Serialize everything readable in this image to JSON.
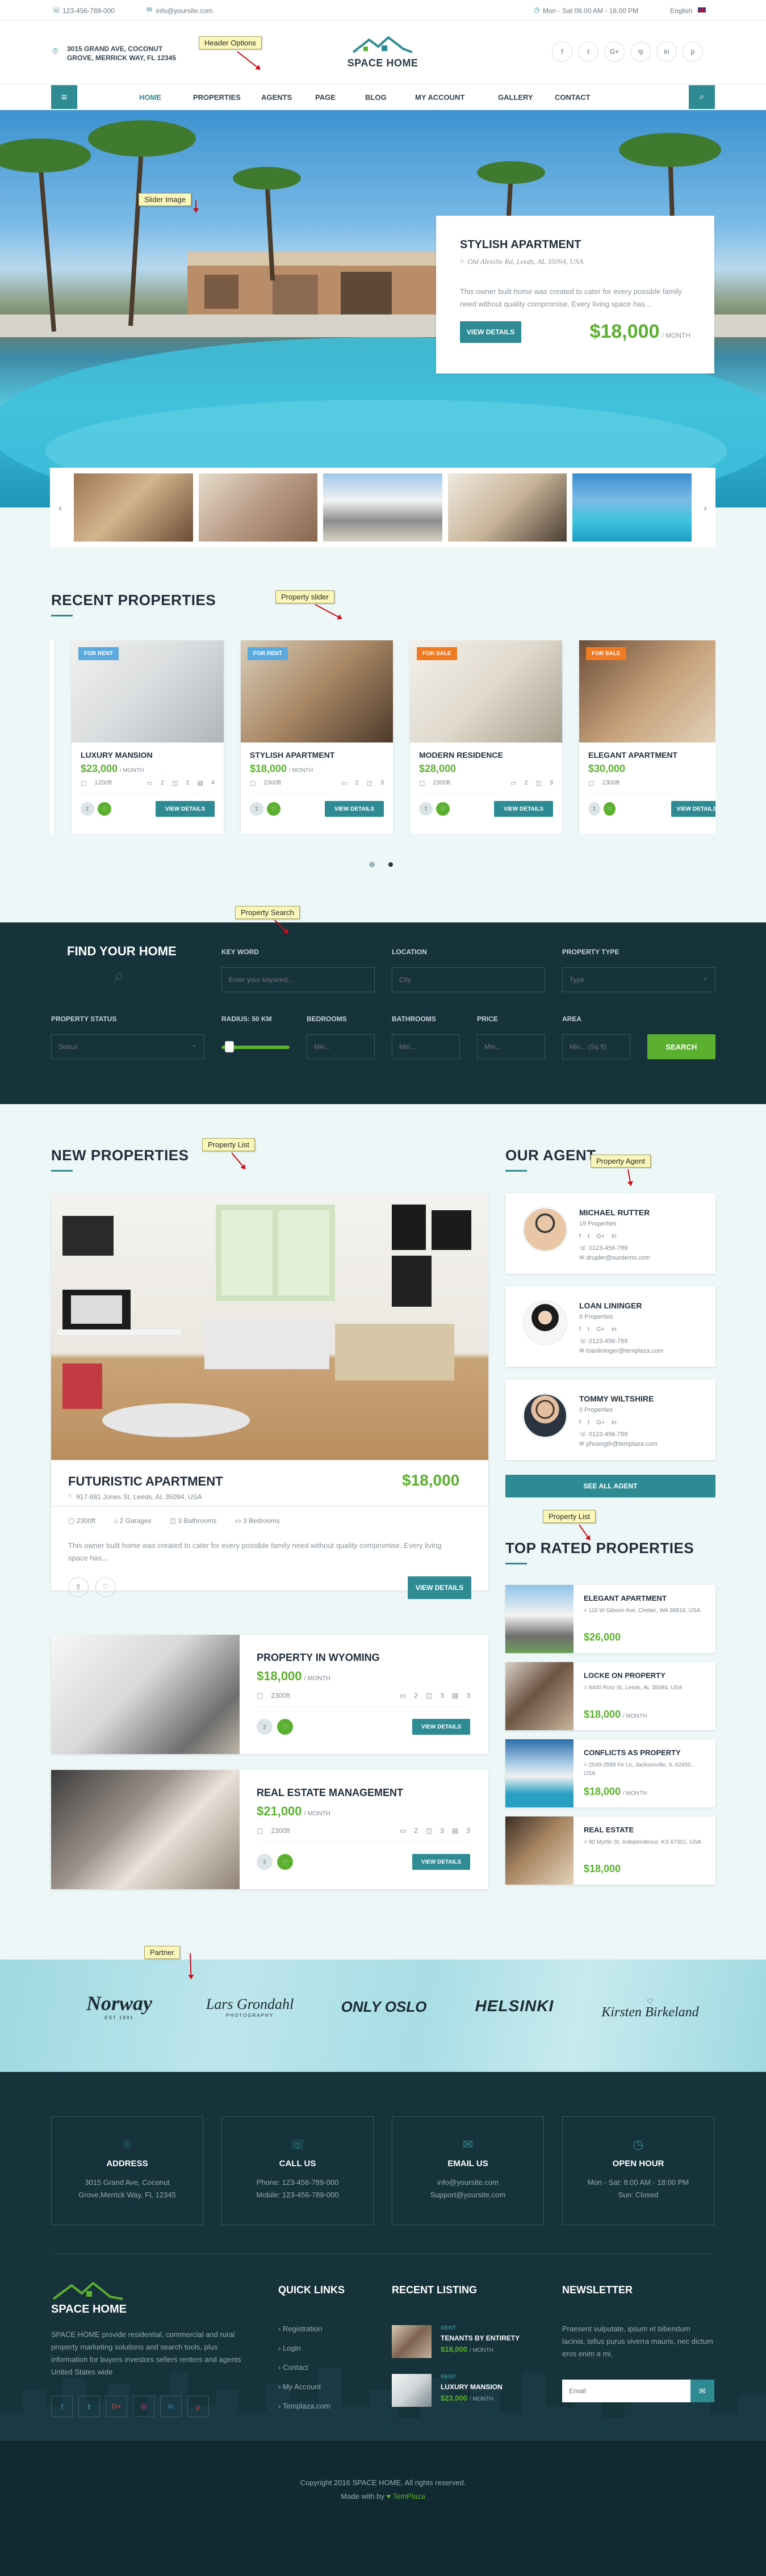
{
  "topbar": {
    "phone": "123-456-789-000",
    "email": "info@yoursite.com",
    "hours": "Mon - Sat 08.00 AM - 18.00 PM",
    "language": "English"
  },
  "header": {
    "address": "3015 GRAND AVE, COCONUT GROVE, MERRICK WAY, FL 12345",
    "logo_text": "SPACE HOME",
    "social": [
      "f",
      "t",
      "G+",
      "ig",
      "in",
      "p"
    ]
  },
  "nav": {
    "items": [
      "HOME",
      "PROPERTIES",
      "AGENTS",
      "PAGE",
      "BLOG",
      "MY ACCOUNT",
      "GALLERY",
      "CONTACT"
    ]
  },
  "callouts": {
    "header_options": "Header Options",
    "slider_image": "Slider Image",
    "property_slider": "Property slider",
    "property_search": "Property Search",
    "property_list": "Property List",
    "property_agent": "Property Agent",
    "property_list_2": "Property List",
    "partner": "Partner"
  },
  "hero": {
    "title": "STYLISH APARTMENT",
    "address": "Old Alexille Rd, Leeds, AL 35094, USA",
    "description": "This owner built home was created to cater for every possible family need without quality compromise. Every living space has...",
    "button": "VIEW DETAILS",
    "price": "$18,000",
    "price_unit": "/ MONTH"
  },
  "recent": {
    "title": "RECENT PROPERTIES",
    "items": [
      {
        "badge": "FOR RENT",
        "name": "LUXURY MANSION",
        "price": "$23,000",
        "unit": "/ MONTH",
        "area": "1200ft",
        "beds": "2",
        "baths": "2",
        "rooms": "4",
        "button": "VIEW DETAILS"
      },
      {
        "badge": "FOR RENT",
        "name": "STYLISH APARTMENT",
        "price": "$18,000",
        "unit": "/ MONTH",
        "area": "2300ft",
        "beds": "2",
        "baths": "3",
        "rooms": "",
        "button": "VIEW DETAILS"
      },
      {
        "badge": "FOR SALE",
        "name": "MODERN RESIDENCE",
        "price": "$28,000",
        "unit": "",
        "area": "2300ft",
        "beds": "2",
        "baths": "3",
        "rooms": "",
        "button": "VIEW DETAILS"
      },
      {
        "badge": "FOR SALE",
        "name": "ELEGANT APARTMENT",
        "price": "$30,000",
        "unit": "",
        "area": "2300ft",
        "beds": "",
        "baths": "",
        "rooms": "",
        "button": "VIEW DETAILS"
      }
    ]
  },
  "search": {
    "title": "FIND YOUR HOME",
    "keyword_label": "KEY WORD",
    "keyword_placeholder": "Enter your keyword...",
    "location_label": "LOCATION",
    "location_placeholder": "City",
    "type_label": "PROPERTY TYPE",
    "type_placeholder": "Type",
    "status_label": "PROPERTY STATUS",
    "status_placeholder": "Status",
    "radius_label": "RADIUS: 50 KM",
    "bedrooms_label": "BEDROOMS",
    "bedrooms_placeholder": "Min...",
    "bathrooms_label": "BATHROOMS",
    "bathrooms_placeholder": "Min...",
    "price_label": "PRICE",
    "price_placeholder": "Min...",
    "area_label": "AREA",
    "area_placeholder": "Min... (Sq ft)",
    "button": "SEARCH",
    "radius_fraction": 0.25
  },
  "new_props": {
    "title": "NEW PROPERTIES",
    "featured": {
      "name": "FUTURISTIC APARTMENT",
      "price": "$18,000",
      "address": "917-881 Jones St, Leeds, AL 35094, USA",
      "area": "2300ft",
      "garages": "2 Garages",
      "baths": "3 Bathrooms",
      "beds": "3 Bedrooms",
      "description": "This owner built home was created to cater for every possible family need without quality compromise. Every living space has...",
      "button": "VIEW DETAILS"
    },
    "list": [
      {
        "name": "PROPERTY IN WYOMING",
        "price": "$18,000",
        "unit": "/ MONTH",
        "area": "2300ft",
        "beds": "2",
        "baths": "3",
        "rooms": "3",
        "button": "VIEW DETAILS"
      },
      {
        "name": "REAL ESTATE MANAGEMENT",
        "price": "$21,000",
        "unit": "/ MONTH",
        "area": "2300ft",
        "beds": "2",
        "baths": "3",
        "rooms": "3",
        "button": "VIEW DETAILS"
      }
    ]
  },
  "agents": {
    "title": "OUR AGENT",
    "items": [
      {
        "name": "MICHAEL RUTTER",
        "props": "19 Properties",
        "phone": "0123-456-789",
        "email": "drupler@ourdemo.com"
      },
      {
        "name": "LOAN LININGER",
        "props": "0 Properties",
        "phone": "0123-456-789",
        "email": "loanlininger@templaza.com"
      },
      {
        "name": "TOMMY WILTSHIRE",
        "props": "0 Properties",
        "phone": "0123-456-789",
        "email": "phuongth@templaza.com"
      }
    ],
    "see_all": "SEE ALL AGENT"
  },
  "top_rated": {
    "title": "TOP RATED PROPERTIES",
    "items": [
      {
        "name": "ELEGANT APARTMENT",
        "address": "110 W Gibson Ave, Chelan, WA 98816, USA",
        "price": "$26,000",
        "unit": ""
      },
      {
        "name": "LOCKE ON PROPERTY",
        "address": "8400 Rosr St, Leeds, AL 35094, USA",
        "price": "$18,000",
        "unit": "/ MONTH"
      },
      {
        "name": "CONFLICTS AS PROPERTY",
        "address": "2549-2599 Fe Ln, Jacksonville, IL 62650, USA",
        "price": "$18,000",
        "unit": "/ MONTH"
      },
      {
        "name": "REAL ESTATE",
        "address": "90 Myrtle St, Independence, KS 67301, USA",
        "price": "$18,000",
        "unit": ""
      }
    ]
  },
  "partners": {
    "items": [
      "Norway",
      "Lars Grondahl",
      "ONLY OSLO",
      "HELSINKI",
      "Kirsten Birkeland"
    ],
    "sublabels": [
      "EST 1991",
      "PHOTOGRAPHY",
      "",
      "",
      ""
    ]
  },
  "contact_boxes": [
    {
      "title": "ADDRESS",
      "line1": "3015 Grand Ave, Coconut",
      "line2": "Grove,Merrick Way, FL 12345"
    },
    {
      "title": "CALL US",
      "line1": "Phone: 123-456-789-000",
      "line2": "Mobile: 123-456-789-000"
    },
    {
      "title": "EMAIL US",
      "line1": "info@yoursite.com",
      "line2": "Support@yoursite.com"
    },
    {
      "title": "OPEN HOUR",
      "line1": "Mon - Sat: 8:00 AM - 18:00 PM",
      "line2": "Sun: Closed"
    }
  ],
  "footer": {
    "logo_text": "SPACE HOME",
    "about": "SPACE HOME provide residential, commercial and rural property marketing solutions and search tools, plus information for buyers investors sellers renters and agents United States wide",
    "quick_title": "QUICK LINKS",
    "quick_links": [
      "Registration",
      "Login",
      "Contact",
      "My Account",
      "Templaza.com"
    ],
    "recent_title": "RECENT LISTING",
    "recent": [
      {
        "badge": "RENT",
        "name": "TENANTS BY ENTIRETY",
        "price": "$18,000",
        "unit": "/ MONTH"
      },
      {
        "badge": "RENT",
        "name": "LUXURY MANSION",
        "price": "$23,000",
        "unit": "/ MONTH"
      }
    ],
    "newsletter_title": "NEWSLETTER",
    "newsletter_text": "Praesent vulputate, ipsum et bibendum lacinia, tellus purus viverra mauris, nec dictum eros enim a mi.",
    "email_placeholder": "Email",
    "copyright": "Copyright 2016 SPACE HOME. All rights reserved.",
    "made_with": "Made with by",
    "made_by": "TemPlaza"
  },
  "colors": {
    "accent": "#2f8b93",
    "green": "#5cb030",
    "dark": "#16323a",
    "orange": "#f07a21",
    "blue": "#5aa9df"
  }
}
